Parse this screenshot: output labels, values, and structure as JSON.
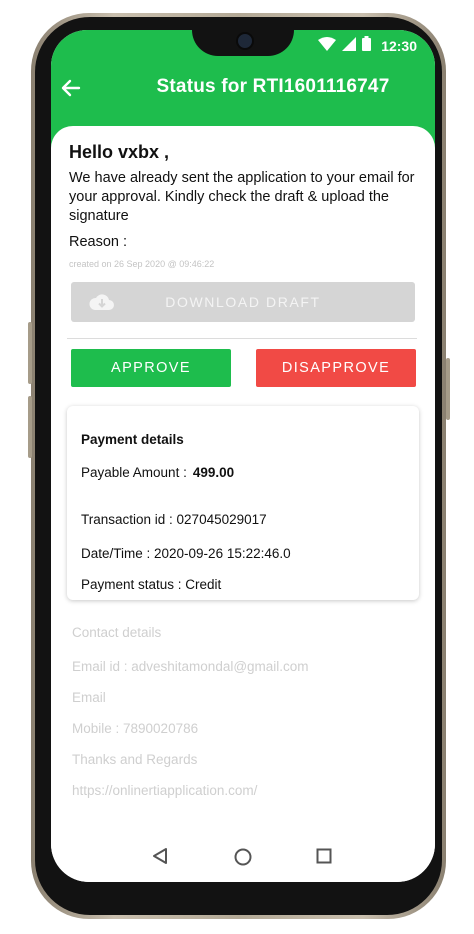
{
  "status_bar": {
    "time": "12:30"
  },
  "app_bar": {
    "title": "Status for RTI1601116747"
  },
  "greeting": "Hello vxbx ,",
  "message": "We have already sent the application to your email for your approval. Kindly check the draft & upload the signature",
  "reason_label": "Reason :",
  "created_text": "created on 26 Sep 2020  @ 09:46:22",
  "buttons": {
    "download": "DOWNLOAD DRAFT",
    "approve": "APPROVE",
    "disapprove": "DISAPPROVE"
  },
  "payment": {
    "title": "Payment details",
    "amount_label": "Payable Amount :",
    "amount_value": "499.00",
    "transaction": "Transaction id : 027045029017",
    "datetime": "Date/Time : 2020-09-26 15:22:46.0",
    "status": "Payment status : Credit"
  },
  "contact": {
    "heading": "Contact details",
    "email_id": "Email id : adveshitamondal@gmail.com",
    "email": "Email",
    "mobile": "Mobile : 7890020786",
    "regards": "Thanks and Regards",
    "url": "https://onlinertiapplication.com/"
  },
  "colors": {
    "primary_green": "#1ebd4d",
    "danger_red": "#f14a45",
    "disabled_grey": "#d5d5d5"
  },
  "icons": {
    "back": "arrow-left-icon",
    "download": "cloud-download-icon",
    "wifi": "wifi-icon",
    "signal": "signal-icon",
    "battery": "battery-icon",
    "nav_back": "triangle-back-icon",
    "nav_home": "circle-home-icon",
    "nav_recents": "square-recents-icon"
  }
}
